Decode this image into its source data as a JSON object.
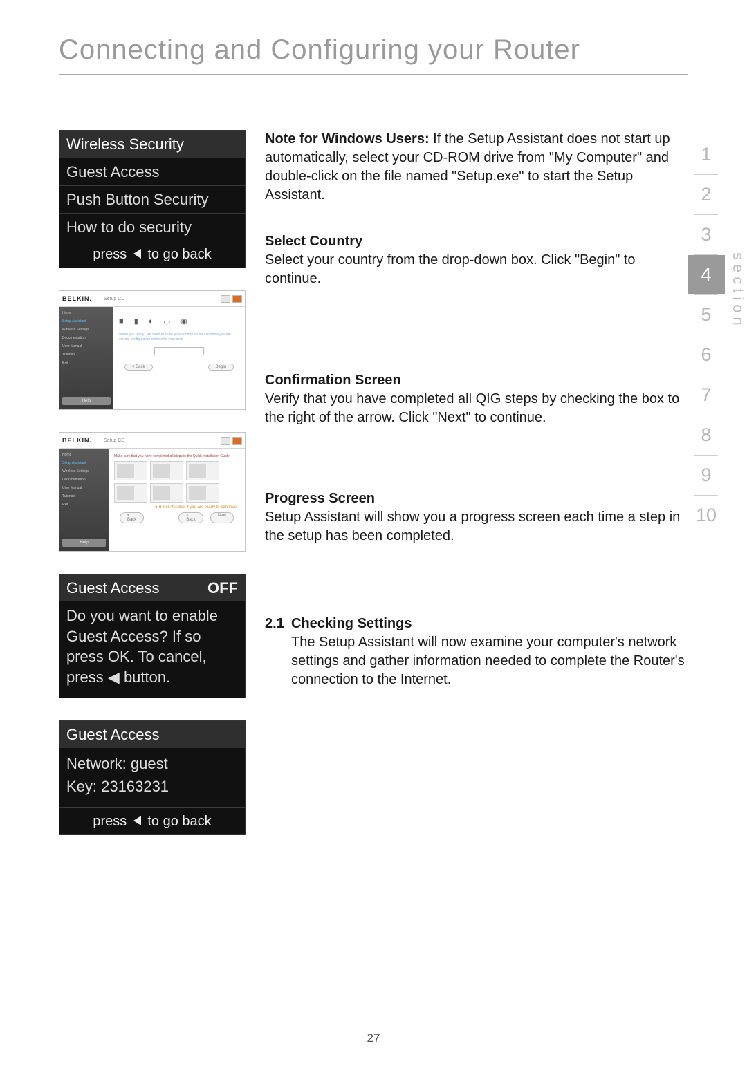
{
  "title": "Connecting and Configuring your Router",
  "page_number": "27",
  "section_nav": {
    "label": "section",
    "items": [
      "1",
      "2",
      "3",
      "4",
      "5",
      "6",
      "7",
      "8",
      "9",
      "10"
    ],
    "active_index": 3
  },
  "lcd1": {
    "row1": "Wireless Security",
    "row2": "Guest Access",
    "row3": "Push Button Security",
    "row4": "How to do security",
    "footer_pre": "press",
    "footer_post": "to go back"
  },
  "belkin_window": {
    "logo": "BELKIN.",
    "subtitle": "Setup CD",
    "side_items": [
      "Home",
      "Setup Assistant",
      "Wireless Settings",
      "Documentation",
      "User Manual",
      "Tutorials",
      "Exit"
    ],
    "icons_text": "■ ▮ ◐ ◡ ◉",
    "hint_text": "When you ready , we need to know your country so we can show you the correct configuration options for your area",
    "help": "Help",
    "back": "< Back",
    "begin": "Begin"
  },
  "belkin_window2": {
    "red_text": "Make sure that you have completed all steps in the Quick Installation Guide",
    "arrow_text": "◄ ■  Tick this box if you are ready to continue",
    "next": "Next"
  },
  "lcd2": {
    "title": "Guest Access",
    "off": "OFF",
    "body": "Do you want to enable Guest Access? If so press OK. To cancel, press ◀ button."
  },
  "lcd3": {
    "title": "Guest Access",
    "network_label": "Network:",
    "network_value": "guest",
    "key_label": "Key:",
    "key_value": "23163231",
    "footer_pre": "press",
    "footer_post": "to go back"
  },
  "right": {
    "note_bold": "Note for Windows Users:",
    "note_rest": " If the Setup Assistant does not start up automatically, select your CD-ROM drive from \"My Computer\" and double-click on the file named \"Setup.exe\" to start the Setup Assistant.",
    "select_country_h": "Select Country",
    "select_country_b": "Select your country from the drop-down box. Click \"Begin\" to continue.",
    "confirm_h": "Confirmation Screen",
    "confirm_b": "Verify that you have completed all QIG steps by checking the box to the right of the arrow. Click \"Next\" to continue.",
    "progress_h": "Progress Screen",
    "progress_b": "Setup Assistant will show you a progress screen each time a step in the setup has been completed.",
    "check_num": "2.1",
    "check_h": "Checking Settings",
    "check_b": "The Setup Assistant will now examine your computer's network settings and gather information needed to complete the Router's connection to the Internet."
  }
}
